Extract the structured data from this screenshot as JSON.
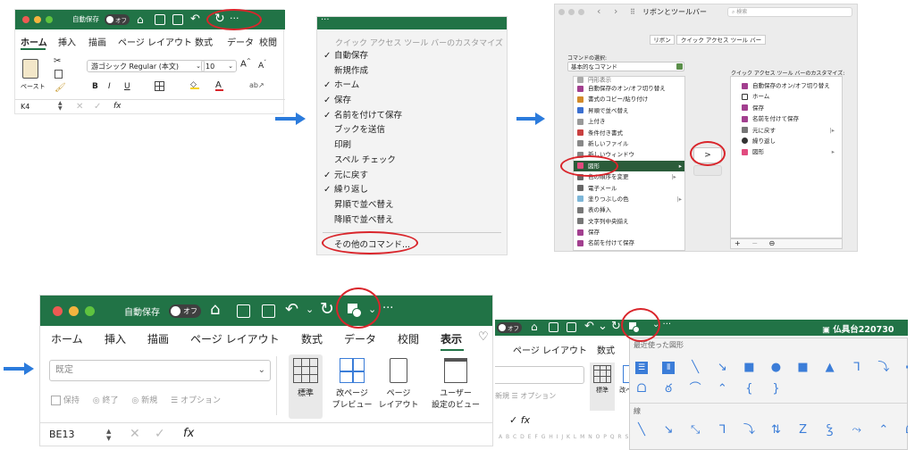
{
  "colors": {
    "excel_green": "#217346",
    "arrow_blue": "#2b7bdc",
    "highlight_red": "#d9252b",
    "selected_row": "#2b5c3a",
    "icon_blue": "#3b7dd8"
  },
  "panel1": {
    "autosave": "自動保存",
    "toggle": "オフ",
    "tabs": [
      "ホーム",
      "挿入",
      "描画",
      "ページ レイアウト",
      "数式",
      "データ",
      "校閲"
    ],
    "font_name": "游ゴシック Regular (本文)",
    "font_size": "10",
    "paste": "ペースト",
    "bold": "B",
    "italic": "I",
    "underline": "U",
    "cell_ref": "K4",
    "fx": "fx"
  },
  "panel2": {
    "header": "クイック アクセス ツール バーのカスタマイズ",
    "items": [
      {
        "check": "✓",
        "label": "自動保存"
      },
      {
        "check": "",
        "label": "新規作成"
      },
      {
        "check": "✓",
        "label": "ホーム"
      },
      {
        "check": "✓",
        "label": "保存"
      },
      {
        "check": "✓",
        "label": "名前を付けて保存"
      },
      {
        "check": "",
        "label": "ブックを送信"
      },
      {
        "check": "",
        "label": "印刷"
      },
      {
        "check": "",
        "label": "スペル チェック"
      },
      {
        "check": "✓",
        "label": "元に戻す"
      },
      {
        "check": "✓",
        "label": "繰り返し"
      },
      {
        "check": "",
        "label": "昇順で並べ替え"
      },
      {
        "check": "",
        "label": "降順で並べ替え"
      }
    ],
    "more": "その他のコマンド..."
  },
  "panel3": {
    "title": "リボンとツールバー",
    "search": "検索",
    "tab_ribbon": "リボン",
    "tab_qat": "クイック アクセス ツール バー",
    "choose_label": "コマンドの選択:",
    "choose_value": "基本的なコマンド",
    "right_label": "クイック アクセス ツール バーのカスタマイズ:",
    "left_items": [
      "自動保存のオン/オフ切り替え",
      "書式のコピー/貼り付け",
      "昇順で並べ替え",
      "上付き",
      "条件付き書式",
      "新しいファイル",
      "新しいウィンドウ",
      "図形",
      "色の順序を変更",
      "電子メール",
      "塗りつぶしの色",
      "表の挿入",
      "文字列中央揃え",
      "保存",
      "名前を付けて保存"
    ],
    "left_first": "円形表示",
    "selected_index": 7,
    "right_items": [
      "自動保存のオン/オフ切り替え",
      "ホーム",
      "保存",
      "名前を付けて保存",
      "元に戻す",
      "繰り返し",
      "図形"
    ],
    "add_btn": ">",
    "bottom_btns": [
      "+",
      "−",
      "⊖"
    ]
  },
  "panel4": {
    "autosave": "自動保存",
    "toggle": "オフ",
    "tabs": [
      "ホーム",
      "挿入",
      "描画",
      "ページ レイアウト",
      "数式",
      "データ",
      "校閲",
      "表示"
    ],
    "view_select": "既定",
    "view_btns": [
      "保持",
      "終了",
      "新規",
      "オプション"
    ],
    "big_btns": [
      {
        "l1": "標準",
        "l2": ""
      },
      {
        "l1": "改ページ",
        "l2": "プレビュー"
      },
      {
        "l1": "ページ",
        "l2": "レイアウト"
      },
      {
        "l1": "ユーザー",
        "l2": "設定のビュー"
      }
    ],
    "cell_ref": "BE13",
    "fx": "fx"
  },
  "panel5": {
    "toggle": "オフ",
    "tab_page": "ページ レイアウト",
    "tab_formula": "数式",
    "new": "新規",
    "options": "オプション",
    "view_std": "標準",
    "view_pb": "改ページ",
    "file_name": "仏具台220730",
    "recent_header": "最近使った図形",
    "line_header": "線",
    "cols": "A B C D E F G H I J K L M N O P Q R S"
  }
}
